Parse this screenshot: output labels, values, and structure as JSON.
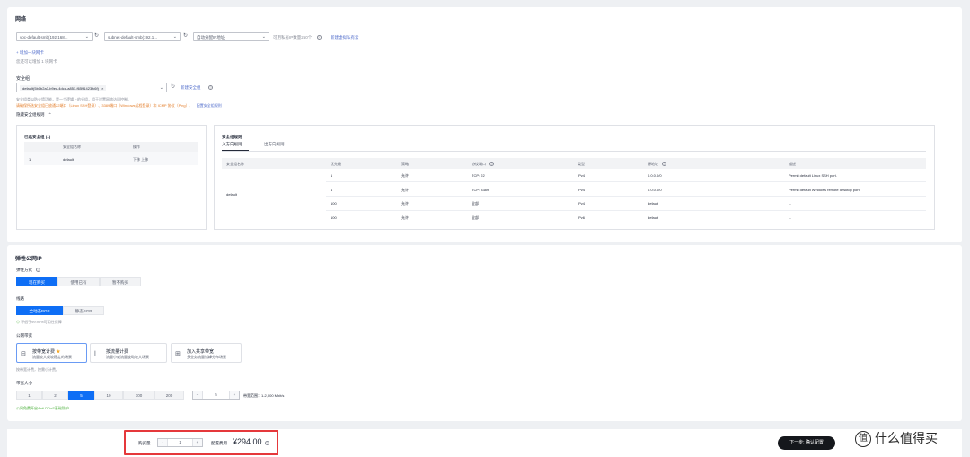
{
  "network": {
    "title": "网络",
    "vpc_select": "vpc-default-smb(192.168...",
    "subnet_select": "subnet-default-smb(192.1...",
    "ip_select": "自动分配IP地址",
    "ip_available": "可用私有IP数量250个",
    "create_subnet_link": "新建虚拟私有云",
    "add_nic_link": "+ 增加一块网卡",
    "nic_remaining": "您还可以增加 1 块网卡",
    "security_group_label": "安全组",
    "sg_tag": "default(5b1b2a3-b9ec-4dca-a851-f6591423fc6f)",
    "create_sg_link": "新建安全组",
    "sg_tip_line1": "安全组类似防火墙功能，是一个逻辑上的分组，用于设置网络访问控制。",
    "sg_tip_line2_warn": "请确保所选安全组已放通22端口（Linux SSH登录）、3389端口（Windows远程登录）和 ICMP 协议（Ping）。",
    "sg_tip_link": "配置安全组规则",
    "hide_rules_link": "隐藏安全组规则"
  },
  "selected_sg": {
    "title": "已选安全组 (1)",
    "headers": [
      "安全组名称",
      "操作"
    ],
    "rows": [
      {
        "idx": "1",
        "name": "default",
        "actions": "下移  上移"
      }
    ]
  },
  "rules": {
    "title": "安全组规则",
    "tabs": [
      "入方向规则",
      "出方向规则"
    ],
    "headers": [
      "安全组名称",
      "优先级",
      "策略",
      "协议端口",
      "类型",
      "源地址",
      "描述"
    ],
    "group_name": "default",
    "rows": [
      {
        "priority": "1",
        "policy": "允许",
        "port": "TCP: 22",
        "type": "IPv4",
        "source": "0.0.0.0/0",
        "desc": "Permit default Linux SSH port."
      },
      {
        "priority": "1",
        "policy": "允许",
        "port": "TCP: 3389",
        "type": "IPv4",
        "source": "0.0.0.0/0",
        "desc": "Permit default Windows remote desktop port."
      },
      {
        "priority": "100",
        "policy": "允许",
        "port": "全部",
        "type": "IPv4",
        "source": "default",
        "desc": "--"
      },
      {
        "priority": "100",
        "policy": "允许",
        "port": "全部",
        "type": "IPv6",
        "source": "default",
        "desc": "--"
      }
    ]
  },
  "eip": {
    "title": "弹性公网IP",
    "mode_label": "弹性方式",
    "mode_options": [
      "现在购买",
      "使用已有",
      "暂不购买"
    ],
    "line_label": "线路",
    "line_options": [
      "全动态BGP",
      "静态BGP"
    ],
    "line_tip": "不低于99.95%可用性保障",
    "bw_label": "公网带宽",
    "bw_cards": [
      {
        "t1": "按带宽计费",
        "t2": "流量较大或较稳定的场景"
      },
      {
        "t1": "按流量计费",
        "t2": "流量小或流量波动较大场景"
      },
      {
        "t1": "加入共享带宽",
        "t2": "多业务流量错峰分布场景"
      }
    ],
    "bw_tip": "按带宽计费，按需小计费。",
    "size_label": "带宽大小",
    "size_options": [
      "1",
      "2",
      "5",
      "10",
      "100",
      "200"
    ],
    "size_value": "5",
    "size_range": "带宽范围：1-2,000 Mbit/s",
    "free_tip": "公网免费开启Anti-DDoS基础防护"
  },
  "footer": {
    "qty_label": "购买量",
    "qty_minus": "-",
    "qty_value": "1",
    "qty_plus": "+",
    "price_label": "配置费用",
    "price": "¥294.00",
    "next_button": "下一步: 确认配置"
  },
  "watermark": {
    "logo": "值",
    "text": "什么值得买"
  }
}
